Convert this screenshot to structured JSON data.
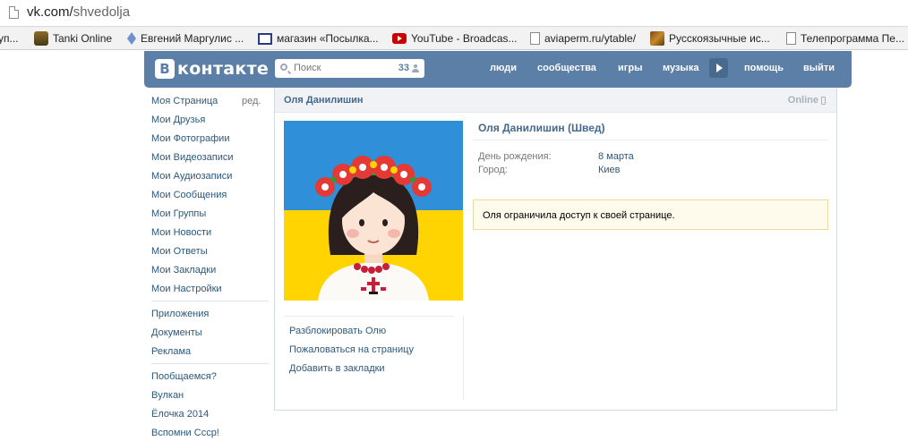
{
  "browser": {
    "url_domain": "vk.com/",
    "url_path": "shvedolja",
    "bookmarks": [
      {
        "label": "уп...",
        "icon": "bookmark-icon"
      },
      {
        "label": "Tanki Online",
        "icon": "tank-icon"
      },
      {
        "label": "Евгений Маргулис ...",
        "icon": "diamond-icon"
      },
      {
        "label": "магазин «Посылка...",
        "icon": "box-icon"
      },
      {
        "label": "YouTube - Broadcas...",
        "icon": "youtube-icon"
      },
      {
        "label": "aviaperm.ru/ytable/",
        "icon": "page-icon"
      },
      {
        "label": "Русскоязычные ис...",
        "icon": "site-icon"
      },
      {
        "label": "Телепрограмма Пе...",
        "icon": "page-icon"
      }
    ]
  },
  "header": {
    "logo_mark": "В",
    "logo_word": "контакте",
    "search_placeholder": "Поиск",
    "search_count": "33",
    "nav": [
      "люди",
      "сообщества",
      "игры",
      "музыка",
      "помощь",
      "выйти"
    ]
  },
  "leftmenu": {
    "edit_label": "ред.",
    "group1": [
      "Моя Страница",
      "Мои Друзья",
      "Мои Фотографии",
      "Мои Видеозаписи",
      "Мои Аудиозаписи",
      "Мои Сообщения",
      "Мои Группы",
      "Мои Новости",
      "Мои Ответы",
      "Мои Закладки",
      "Мои Настройки"
    ],
    "group2": [
      "Приложения",
      "Документы",
      "Реклама"
    ],
    "group3": [
      "Пообщаемся?",
      "Вулкан",
      "Ёлочка 2014",
      "Вспомни Ссср!"
    ]
  },
  "profile": {
    "header_name": "Оля Данилишин",
    "online": "Online",
    "full_name": "Оля Данилишин (Швед)",
    "fields": [
      {
        "label": "День рождения:",
        "value": "8 марта"
      },
      {
        "label": "Город:",
        "value": "Киев"
      }
    ],
    "notice": "Оля ограничила доступ к своей странице.",
    "actions": [
      "Разблокировать Олю",
      "Пожаловаться на страницу",
      "Добавить в закладки"
    ]
  },
  "colors": {
    "vk_blue": "#5b7fa6",
    "link": "#2b587a",
    "flag_blue": "#2f8fd8",
    "flag_yellow": "#ffd400"
  }
}
